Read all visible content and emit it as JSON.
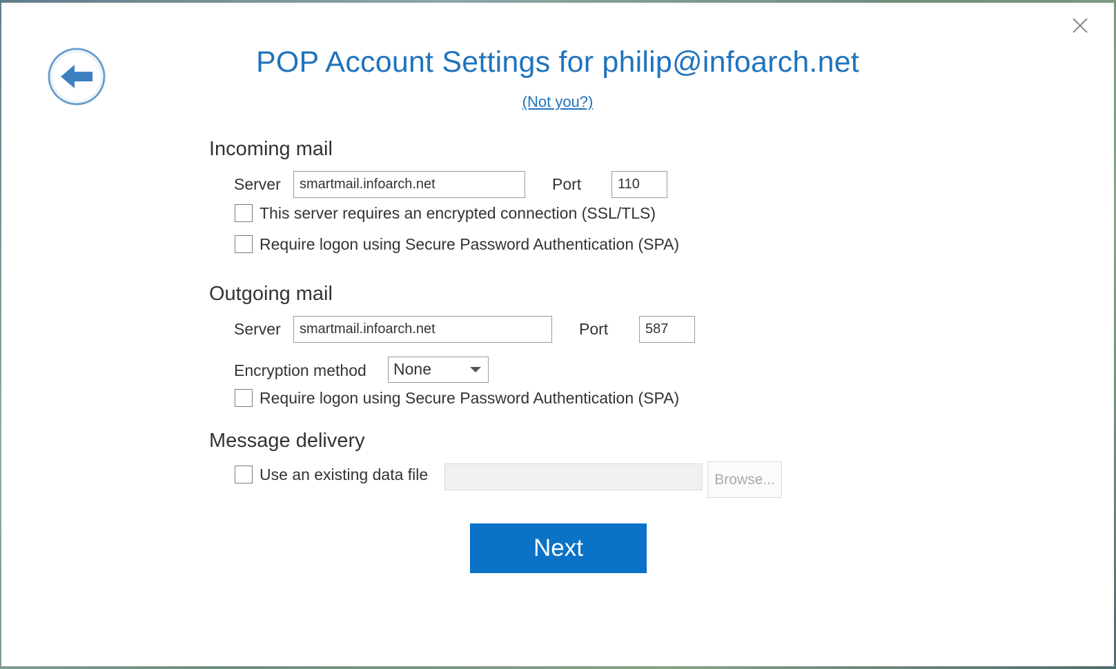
{
  "window": {
    "close_icon": "close-icon",
    "back_icon": "back-arrow-icon"
  },
  "header": {
    "title": "POP Account Settings for philip@infoarch.net",
    "not_you_link": "(Not you?)"
  },
  "incoming": {
    "heading": "Incoming mail",
    "server_label": "Server",
    "server_value": "smartmail.infoarch.net",
    "port_label": "Port",
    "port_value": "110",
    "ssl_checkbox_label": "This server requires an encrypted connection (SSL/TLS)",
    "ssl_checked": false,
    "spa_checkbox_label": "Require logon using Secure Password Authentication (SPA)",
    "spa_checked": false
  },
  "outgoing": {
    "heading": "Outgoing mail",
    "server_label": "Server",
    "server_value": "smartmail.infoarch.net",
    "port_label": "Port",
    "port_value": "587",
    "encryption_label": "Encryption method",
    "encryption_value": "None",
    "spa_checkbox_label": "Require logon using Secure Password Authentication (SPA)",
    "spa_checked": false
  },
  "delivery": {
    "heading": "Message delivery",
    "existing_file_label": "Use an existing data file",
    "existing_file_checked": false,
    "file_path_value": "",
    "browse_label": "Browse..."
  },
  "actions": {
    "next_label": "Next"
  },
  "colors": {
    "accent": "#1f73bd",
    "next_button": "#0a72c7",
    "text": "#333333"
  }
}
